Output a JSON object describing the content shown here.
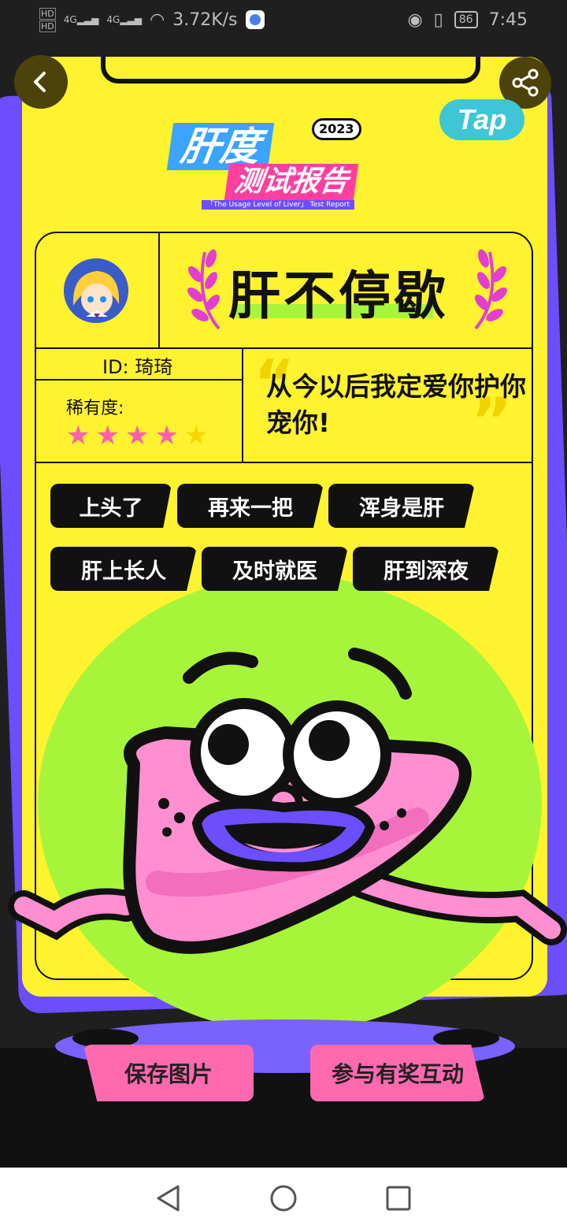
{
  "status_bar": {
    "network_speed": "3.72K/s",
    "signal_1": "4G",
    "signal_2": "4G",
    "hd_1": "HD",
    "hd_2": "HD",
    "battery": "86",
    "time": "7:45"
  },
  "header": {
    "tap_logo": "Tap"
  },
  "report_title": {
    "line1": "肝度",
    "year": "2023",
    "line2": "测试报告",
    "subtitle": "「The Usage Level of Liver」 Test Report"
  },
  "profile": {
    "headline": "肝不停歇",
    "id_label": "ID: 琦琦",
    "rarity_label": "稀有度:",
    "rarity_filled": 4,
    "rarity_max": 5,
    "quote": "从今以后我定爱你护你宠你!"
  },
  "tags": [
    "上头了",
    "再来一把",
    "浑身是肝",
    "肝上长人",
    "及时就医",
    "肝到深夜"
  ],
  "actions": {
    "save_label": "保存图片",
    "participate_label": "参与有奖互动"
  },
  "colors": {
    "card": "#fff22f",
    "accent_purple": "#6c4dff",
    "accent_pink": "#ff69b0",
    "accent_green": "#a7f53a"
  }
}
